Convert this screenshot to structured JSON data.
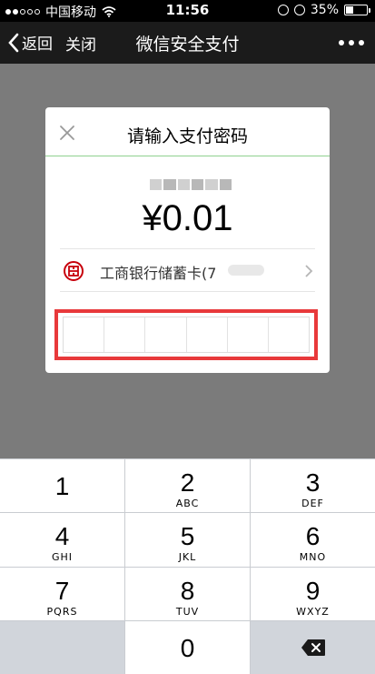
{
  "status_bar": {
    "carrier": "中国移动",
    "time": "11:56",
    "battery": "35%",
    "battery_level": 0.35
  },
  "nav": {
    "back_label": "返回",
    "close_label": "关闭",
    "title": "微信安全支付",
    "more_icon": "more-icon"
  },
  "dialog": {
    "title": "请输入支付密码",
    "amount": "¥0.01",
    "card": {
      "name": "工商银行储蓄卡(7",
      "icon": "icbc-logo-icon"
    },
    "pin_length": 6,
    "highlight_color": "#e8393b"
  },
  "keypad": {
    "keys": [
      {
        "num": "1",
        "letters": ""
      },
      {
        "num": "2",
        "letters": "ABC"
      },
      {
        "num": "3",
        "letters": "DEF"
      },
      {
        "num": "4",
        "letters": "GHI"
      },
      {
        "num": "5",
        "letters": "JKL"
      },
      {
        "num": "6",
        "letters": "MNO"
      },
      {
        "num": "7",
        "letters": "PQRS"
      },
      {
        "num": "8",
        "letters": "TUV"
      },
      {
        "num": "9",
        "letters": "WXYZ"
      },
      {
        "num": "0",
        "letters": ""
      }
    ],
    "delete_icon": "backspace-icon"
  }
}
